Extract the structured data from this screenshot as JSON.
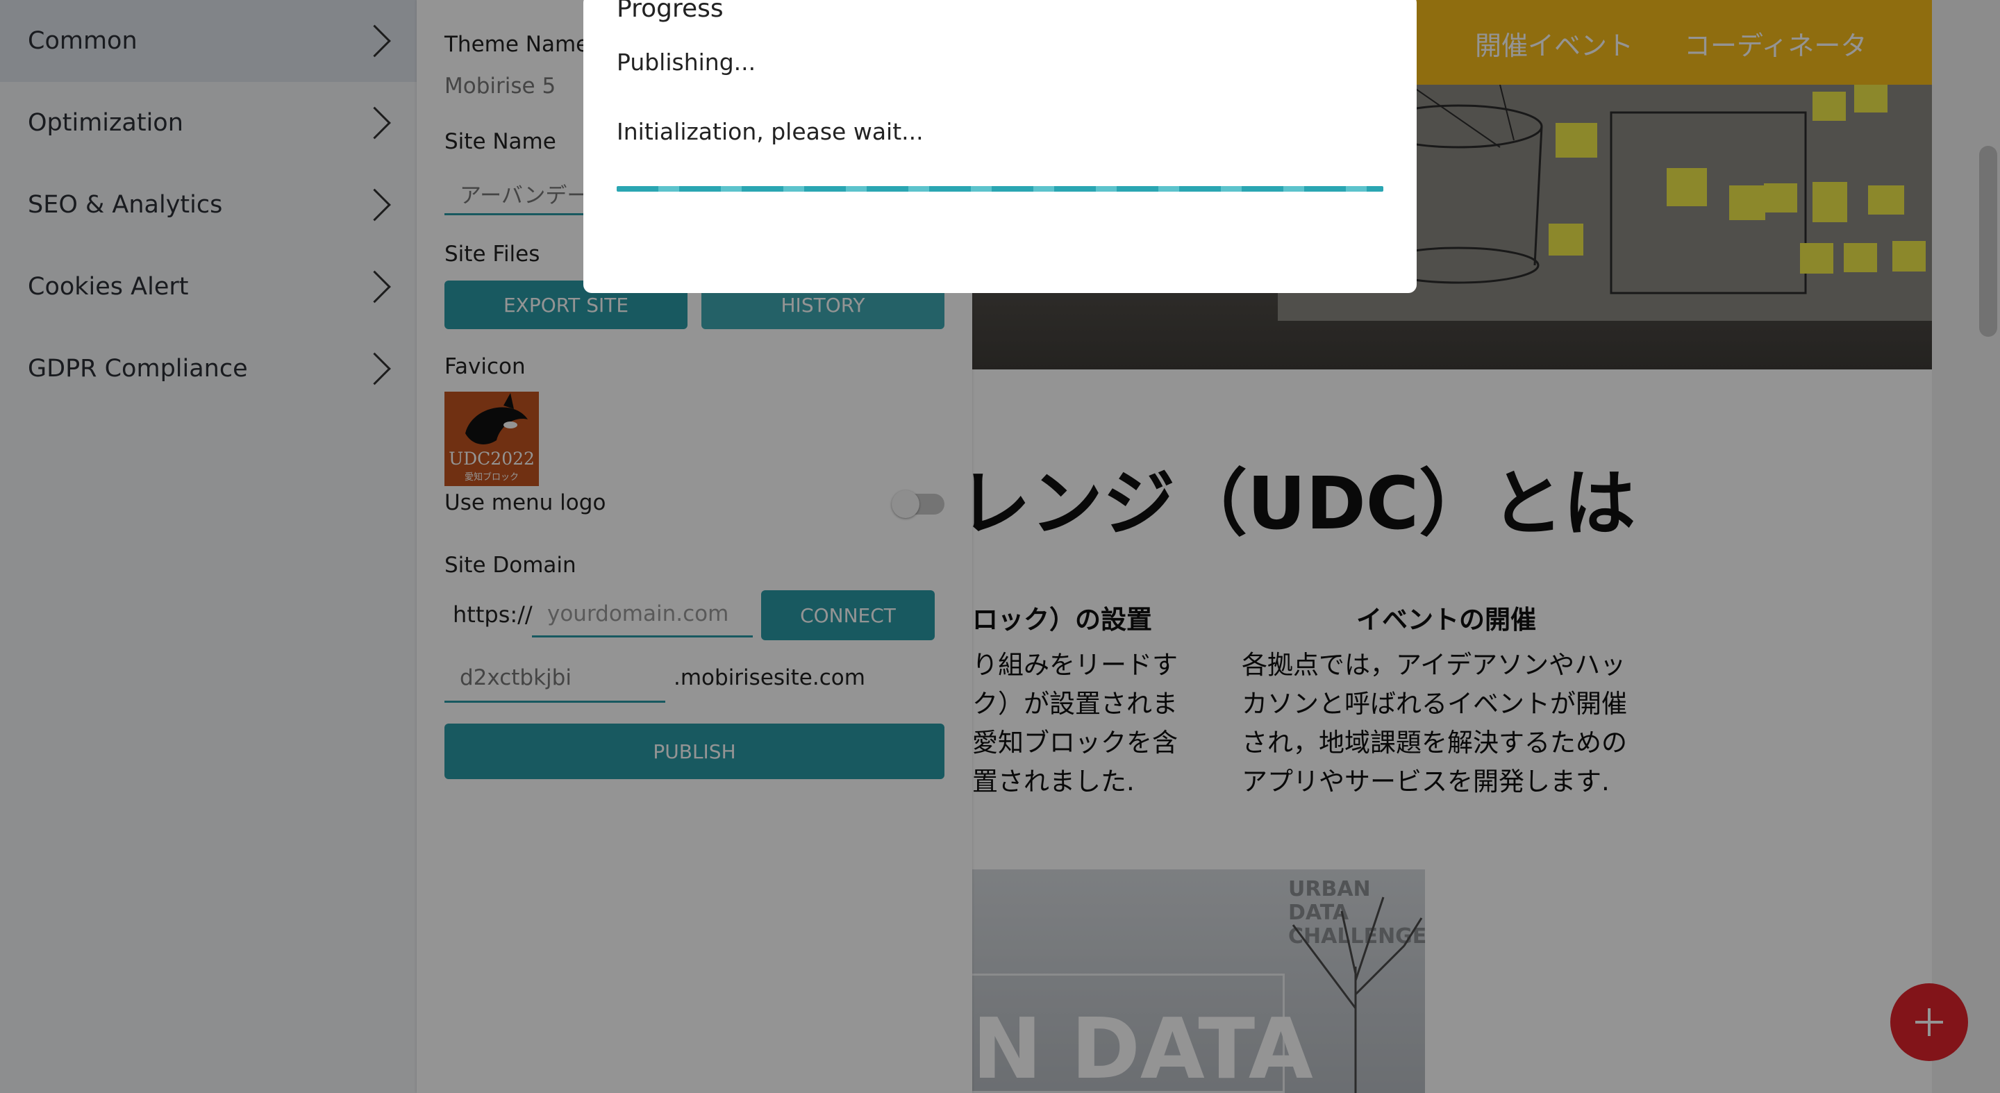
{
  "sidebar": {
    "items": [
      {
        "label": "Common",
        "active": true
      },
      {
        "label": "Optimization",
        "active": false
      },
      {
        "label": "SEO & Analytics",
        "active": false
      },
      {
        "label": "Cookies Alert",
        "active": false
      },
      {
        "label": "GDPR Compliance",
        "active": false
      }
    ]
  },
  "panel": {
    "theme_name_label": "Theme Name",
    "theme_name_value": "Mobirise 5",
    "site_name_label": "Site Name",
    "site_name_value": "アーバンデー",
    "site_files_label": "Site Files",
    "export_site_label": "EXPORT SITE",
    "history_label": "HISTORY",
    "favicon_label": "Favicon",
    "favicon_text": "UDC2022",
    "favicon_subtext": "愛知ブロック",
    "use_menu_logo_label": "Use menu logo",
    "use_menu_logo_on": false,
    "site_domain_label": "Site Domain",
    "domain_prefix": "https://",
    "domain_placeholder": "yourdomain.com",
    "connect_label": "CONNECT",
    "subdomain_value": "d2xctbkjbi",
    "subdomain_suffix": ".mobirisesite.com",
    "publish_label": "PUBLISH"
  },
  "modal": {
    "title": "Progress",
    "status": "Publishing...",
    "message": "Initialization, please wait...",
    "progress": 1.0
  },
  "preview": {
    "nav_links": [
      "開催イベント",
      "コーディネータ"
    ],
    "nav_color": "#f7bc1b",
    "heading": "レンジ（UDC）とは",
    "col1_title": "ロック）の設置",
    "col1_lines": [
      "り組みをリードす",
      "ク）が設置されま",
      "愛知ブロックを含",
      "置されました."
    ],
    "col2_title": "イベントの開催",
    "col2_lines": [
      "各拠点では，アイデアソンやハッ",
      "カソンと呼ばれるイベントが開催",
      "され，地域課題を解決するための",
      "アプリやサービスを開発します."
    ],
    "photo_caption_1": "URBAN DATA",
    "photo_caption_2": "CHALLENGE",
    "photo_big_text": "N DATA"
  },
  "colors": {
    "accent": "#2a9aa5",
    "fab": "#e0232b"
  }
}
